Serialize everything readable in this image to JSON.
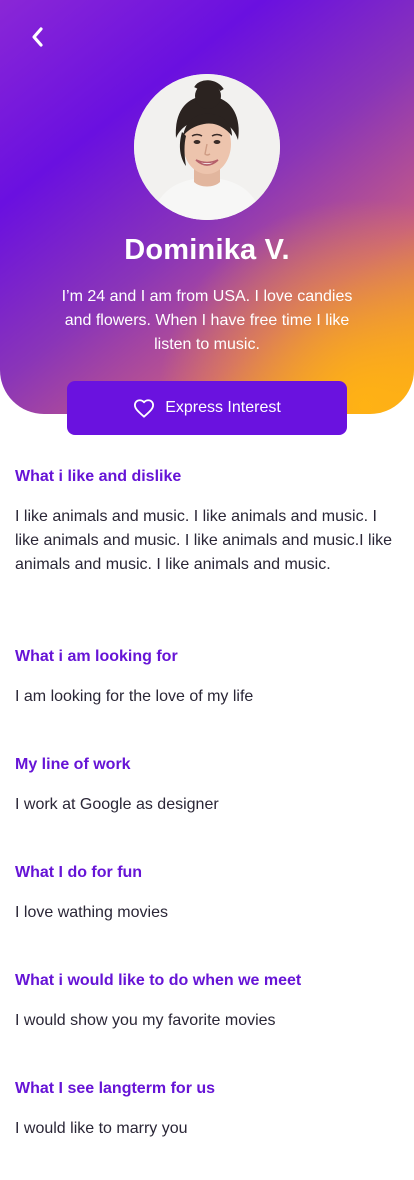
{
  "nav": {
    "back_icon": "chevron-left-icon"
  },
  "profile": {
    "name": "Dominika V.",
    "bio": "I’m 24 and I am from USA. I love candies and flowers. When I have free time I like listen to music."
  },
  "cta": {
    "label": "Express Interest",
    "icon": "heart-icon"
  },
  "colors": {
    "accent": "#6a12df",
    "heading": "#6614d6",
    "gradient_start": "#6a10e0",
    "gradient_end": "#ffb214"
  },
  "sections": [
    {
      "title": "What i like and dislike",
      "text": "I like animals and music. I like animals and music. I like animals and music. I like animals and music.I like animals and music. I like animals and music."
    },
    {
      "title": "What i am looking for",
      "text": "I am looking for the love of my life"
    },
    {
      "title": "My line of work",
      "text": "I work at Google as designer"
    },
    {
      "title": "What I do for fun",
      "text": "I love wathing movies"
    },
    {
      "title": "What i would like to do when we meet",
      "text": "I would show you my favorite movies"
    },
    {
      "title": "What I see langterm for us",
      "text": "I would like to marry you"
    }
  ]
}
